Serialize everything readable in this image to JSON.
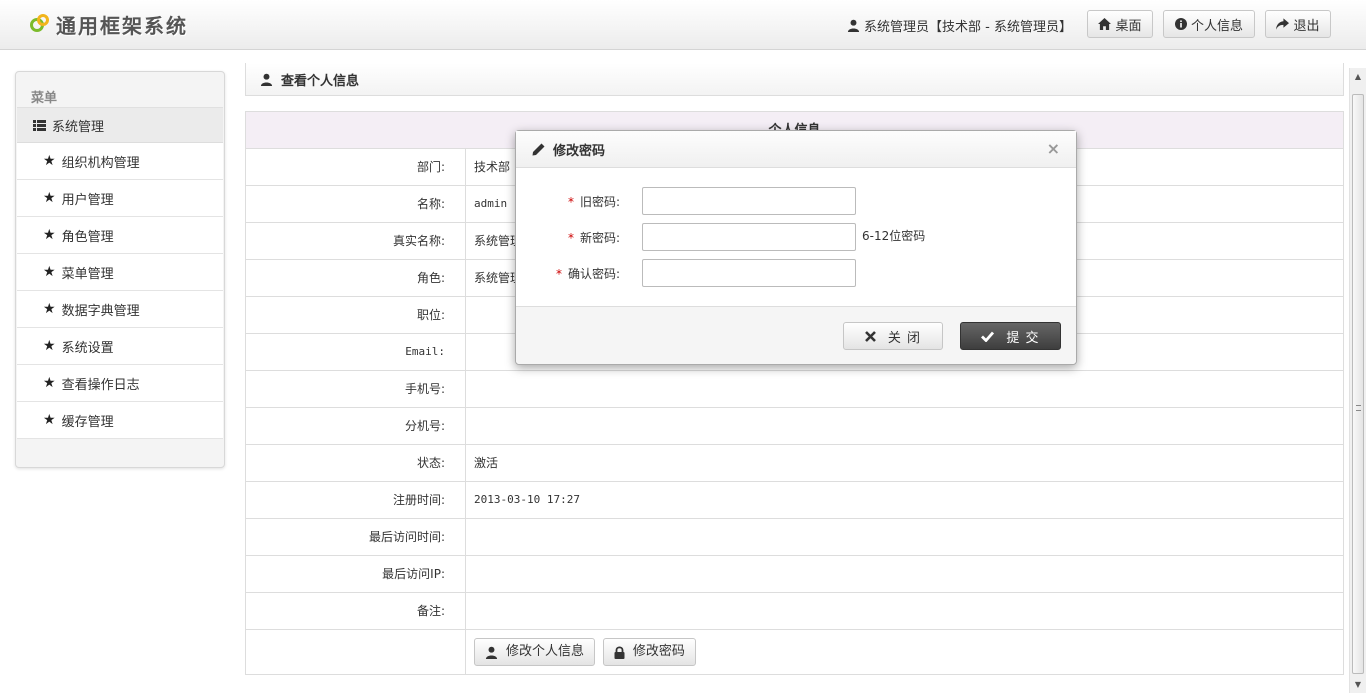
{
  "header": {
    "app_title": "通用框架系统",
    "user_text": "系统管理员【技术部 - 系统管理员】",
    "desktop_label": "桌面",
    "profile_label": "个人信息",
    "logout_label": "退出"
  },
  "sidebar": {
    "title": "菜单",
    "group_label": "系统管理",
    "items": [
      {
        "label": "组织机构管理"
      },
      {
        "label": "用户管理"
      },
      {
        "label": "角色管理"
      },
      {
        "label": "菜单管理"
      },
      {
        "label": "数据字典管理"
      },
      {
        "label": "系统设置"
      },
      {
        "label": "查看操作日志"
      },
      {
        "label": "缓存管理"
      }
    ]
  },
  "page": {
    "title": "查看个人信息",
    "panel_title": "个人信息",
    "fields": [
      {
        "label": "部门:",
        "value": "技术部"
      },
      {
        "label": "名称:",
        "value": "admin"
      },
      {
        "label": "真实名称:",
        "value": "系统管理员"
      },
      {
        "label": "角色:",
        "value": "系统管理员"
      },
      {
        "label": "职位:",
        "value": ""
      },
      {
        "label": "Email:",
        "value": ""
      },
      {
        "label": "手机号:",
        "value": ""
      },
      {
        "label": "分机号:",
        "value": ""
      },
      {
        "label": "状态:",
        "value": "激活"
      },
      {
        "label": "注册时间:",
        "value": "2013-03-10 17:27"
      },
      {
        "label": "最后访问时间:",
        "value": ""
      },
      {
        "label": "最后访问IP:",
        "value": ""
      },
      {
        "label": "备注:",
        "value": ""
      }
    ],
    "edit_profile_label": "修改个人信息",
    "change_password_label": "修改密码"
  },
  "modal": {
    "title": "修改密码",
    "close_symbol": "×",
    "required_mark": "*",
    "old_password_label": "旧密码:",
    "old_password_value": "",
    "new_password_label": "新密码:",
    "new_password_value": "",
    "new_password_hint": "6-12位密码",
    "confirm_password_label": "确认密码:",
    "confirm_password_value": "",
    "close_label": "关 闭",
    "submit_label": "提 交"
  },
  "colors": {
    "panel_title_bg": "#f4eef5",
    "required": "#cc0000",
    "submit_bg": "#4a4a4a"
  }
}
